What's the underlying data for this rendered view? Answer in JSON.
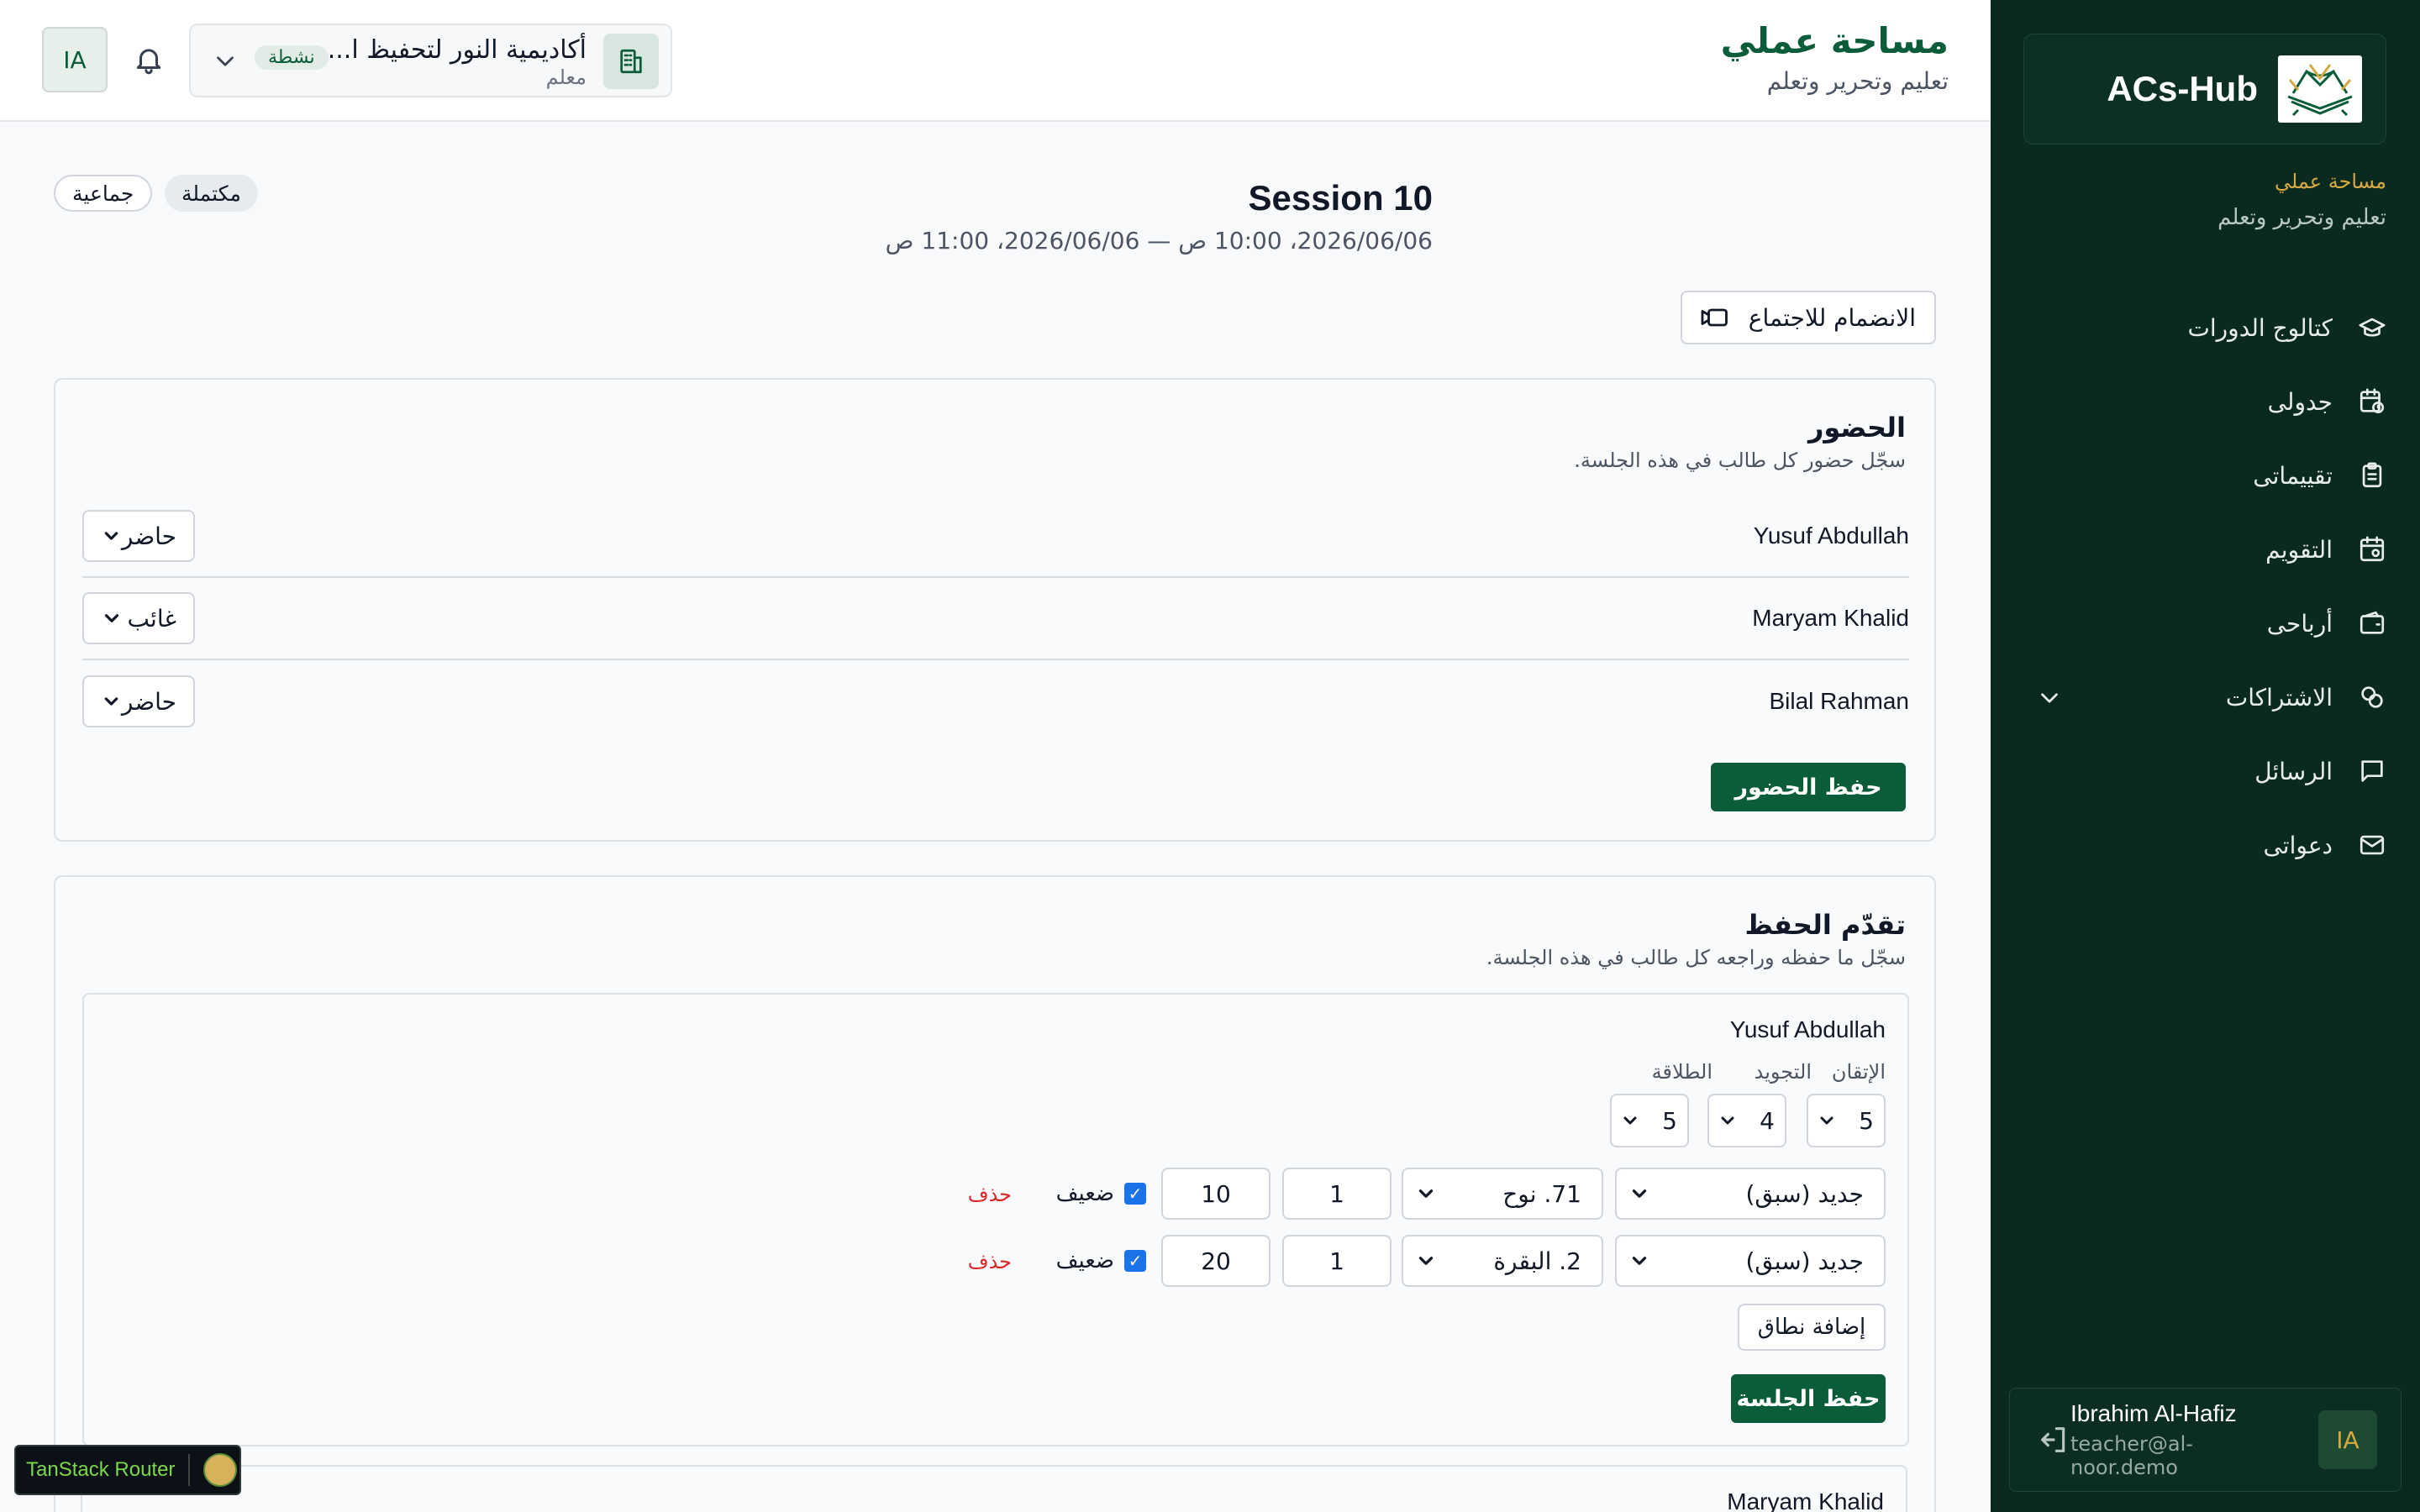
{
  "sidebar": {
    "brand": "ACs-Hub",
    "workspace_title": "مساحة عملي",
    "workspace_sub": "تعليم وتحرير وتعلم",
    "items": [
      {
        "label": "كتالوج الدورات",
        "icon": "graduation-cap-icon"
      },
      {
        "label": "جدولى",
        "icon": "calendar-clock-icon"
      },
      {
        "label": "تقييماتى",
        "icon": "clipboard-list-icon"
      },
      {
        "label": "التقويم",
        "icon": "calendar-icon"
      },
      {
        "label": "أرباحى",
        "icon": "wallet-icon"
      },
      {
        "label": "الاشتراكات",
        "icon": "badge-percent-icon"
      },
      {
        "label": "الرسائل",
        "icon": "message-square-icon"
      },
      {
        "label": "دعواتى",
        "icon": "mail-icon"
      }
    ],
    "user": {
      "initials": "IA",
      "name": "Ibrahim Al-Hafiz",
      "email": "teacher@al-noor.demo"
    }
  },
  "header": {
    "title": "مساحة عملي",
    "subtitle": "تعليم وتحرير وتعلم",
    "org_name": "أكاديمية النور لتحفيظ ا...",
    "org_role": "معلم",
    "org_status": "نشطة",
    "avatar": "IA"
  },
  "session": {
    "title": "Session 10",
    "date": "2026/06/06، 10:00 ص — 2026/06/06، 11:00 ص",
    "status": "مكتملة",
    "type": "جماعية",
    "join_label": "الانضمام للاجتماع"
  },
  "attendance": {
    "title": "الحضور",
    "subtitle": "سجّل حضور كل طالب في هذه الجلسة.",
    "rows": [
      {
        "name": "Yusuf Abdullah",
        "status": "حاضر"
      },
      {
        "name": "Maryam Khalid",
        "status": "غائب"
      },
      {
        "name": "Bilal Rahman",
        "status": "حاضر"
      }
    ],
    "save_label": "حفظ الحضور"
  },
  "memorization": {
    "title": "تقدّم الحفظ",
    "subtitle": "سجّل ما حفظه وراجعه كل طالب في هذه الجلسة.",
    "student": "Yusuf Abdullah",
    "labels": {
      "mastery": "الإتقان",
      "tajweed": "التجويد",
      "fluency": "الطلاقة"
    },
    "scores": {
      "mastery": "5",
      "tajweed": "4",
      "fluency": "5"
    },
    "ranges": [
      {
        "type": "جديد (سبق)",
        "surah": "71. نوح",
        "from": "1",
        "to": "10",
        "weak": "ضعيف",
        "delete": "حذف"
      },
      {
        "type": "جديد (سبق)",
        "surah": "2. البقرة",
        "from": "1",
        "to": "20",
        "weak": "ضعيف",
        "delete": "حذف"
      }
    ],
    "add_range": "إضافة نطاق",
    "save_label": "حفظ الجلسة",
    "next_student": "Maryam Khalid"
  },
  "devtools": {
    "label": "TanStack Router"
  },
  "colors": {
    "primary": "#0b5d3a",
    "sidebar": "#0a2a1f",
    "accent": "#d4a843",
    "danger": "#dc2626"
  }
}
